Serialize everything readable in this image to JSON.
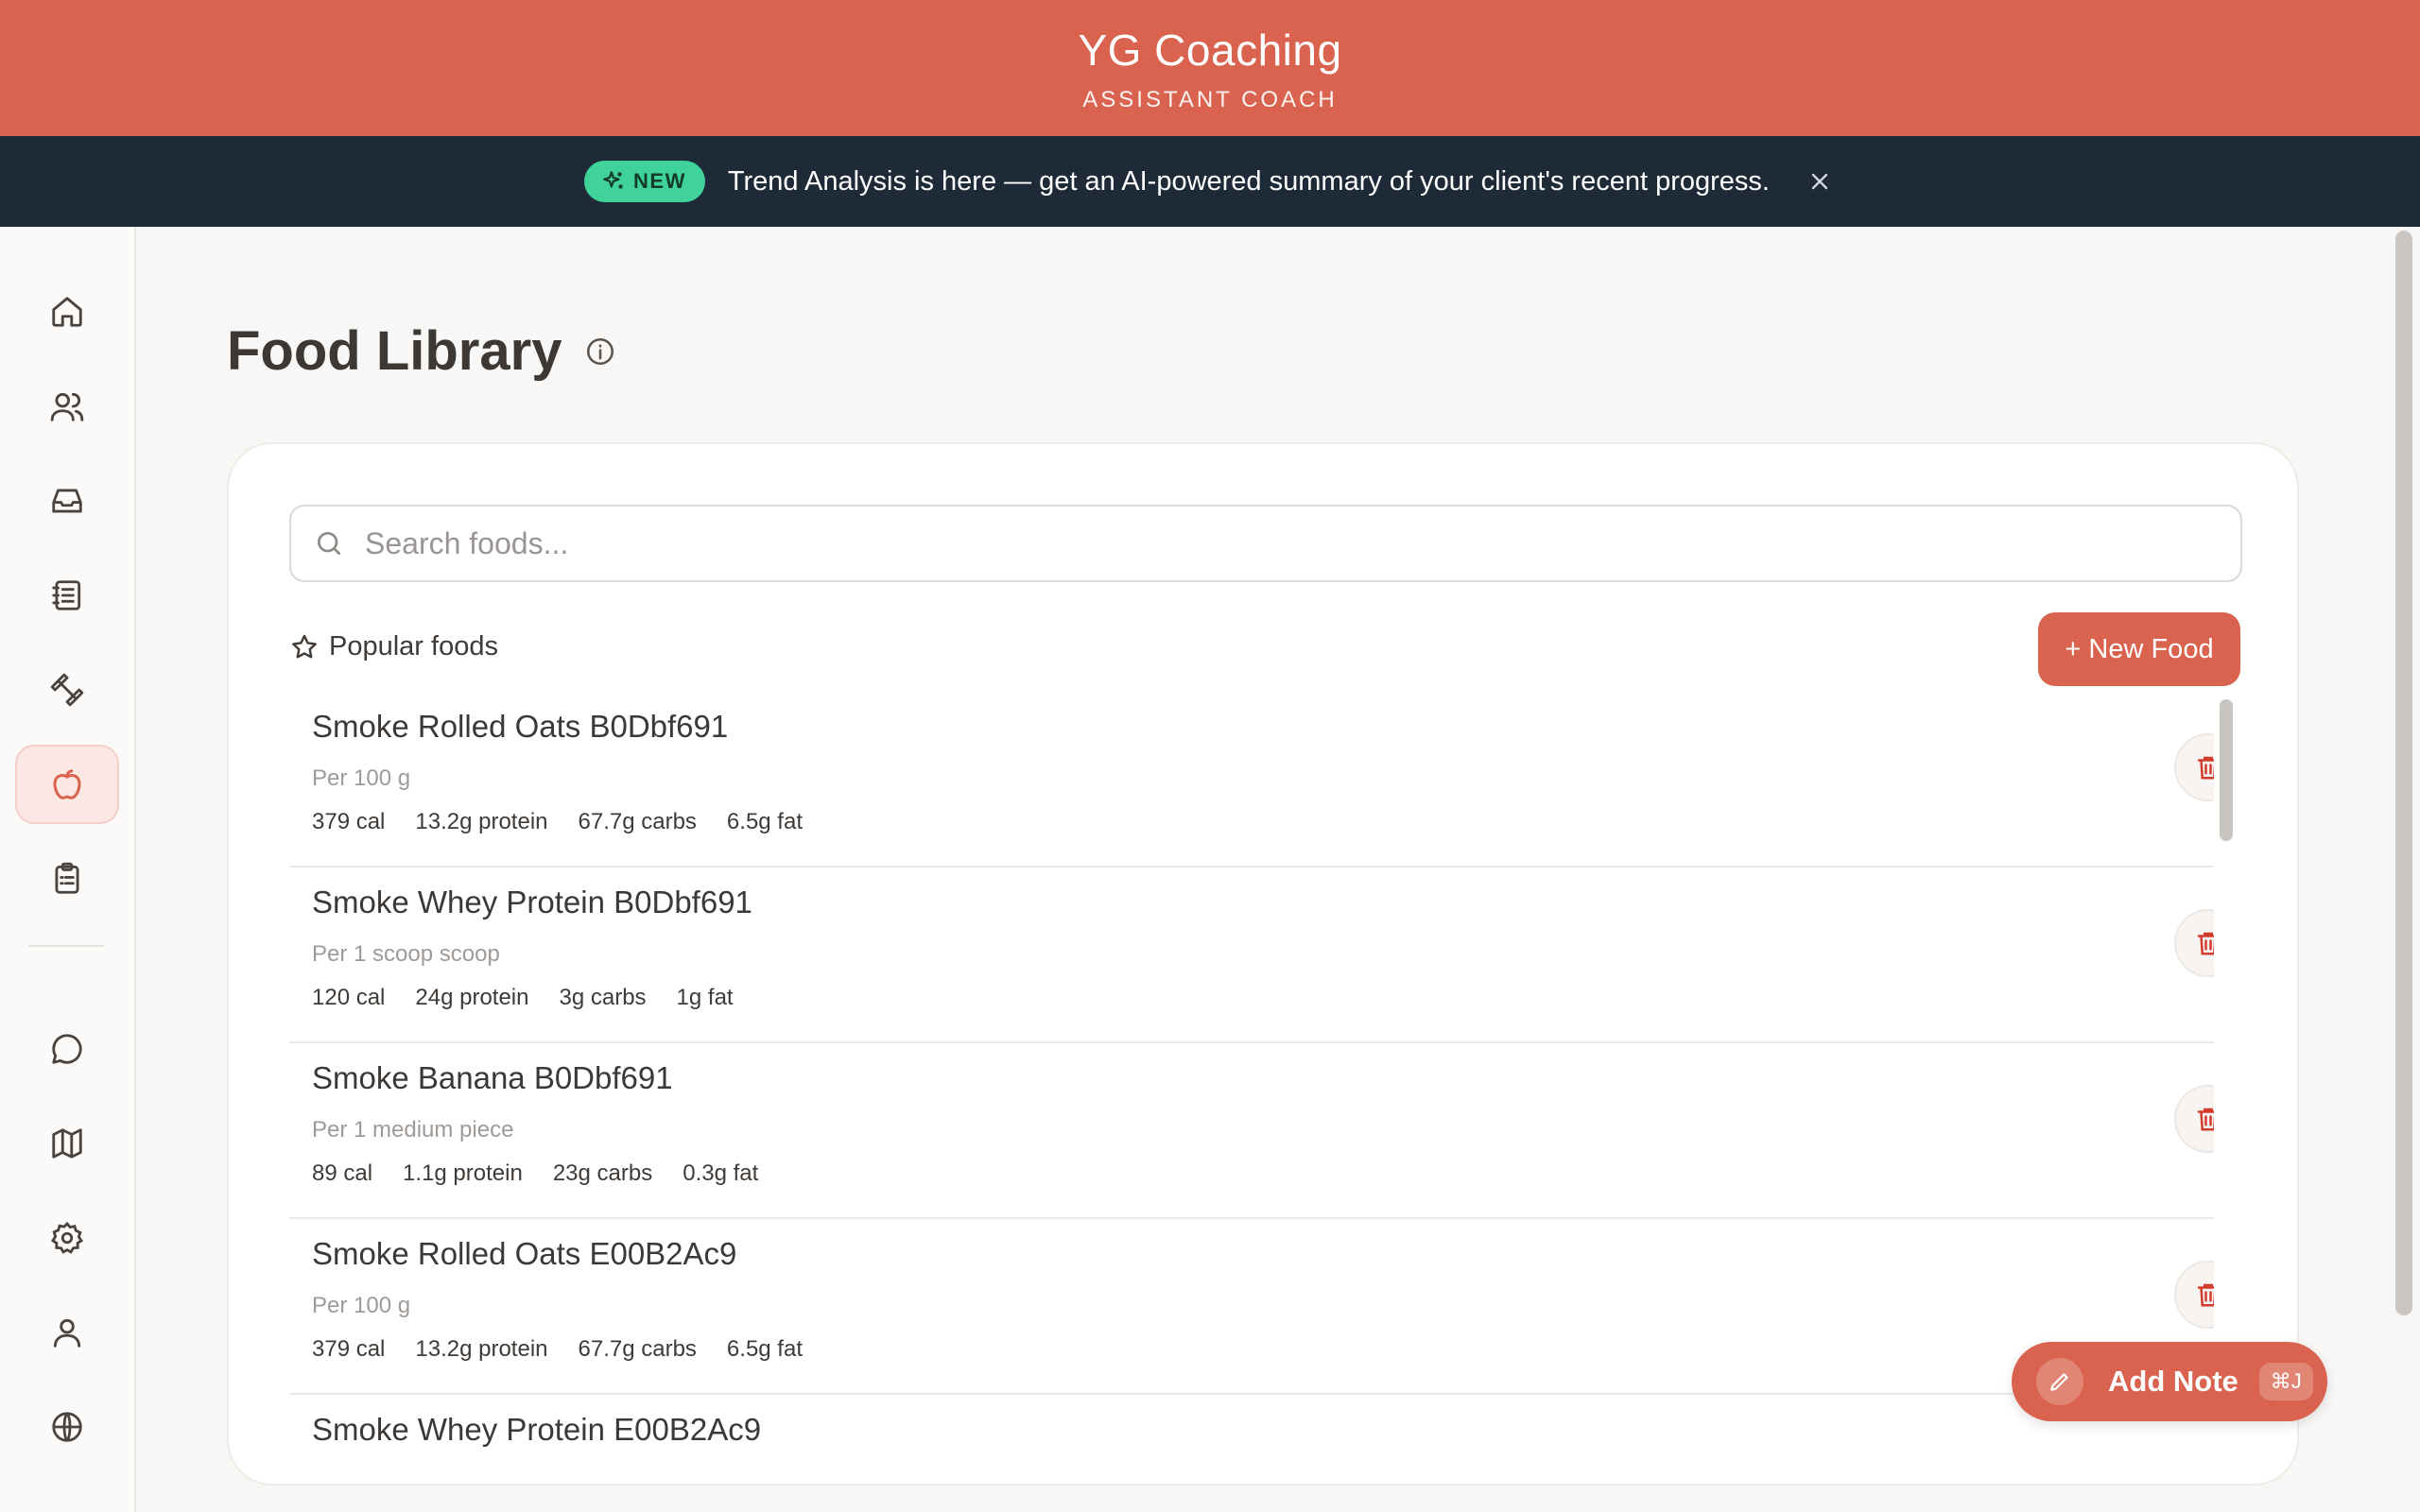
{
  "header": {
    "brand": "YG Coaching",
    "subtitle": "ASSISTANT COACH",
    "color": "#d9634f"
  },
  "announcement": {
    "badge": "NEW",
    "message": "Trend Analysis is here — get an AI-powered summary of your client's recent progress.",
    "icons": [
      "sparkle-icon",
      "close-icon"
    ]
  },
  "sidebar": {
    "items": [
      {
        "icon": "home-icon",
        "active": false
      },
      {
        "icon": "users-icon",
        "active": false
      },
      {
        "icon": "inbox-icon",
        "active": false
      },
      {
        "icon": "notebook-icon",
        "active": false
      },
      {
        "icon": "dumbbell-icon",
        "active": false
      },
      {
        "icon": "apple-icon",
        "active": true
      },
      {
        "icon": "clipboard-icon",
        "active": false
      },
      {
        "icon": "chat-icon",
        "active": false
      },
      {
        "icon": "map-icon",
        "active": false
      },
      {
        "icon": "gear-icon",
        "active": false
      },
      {
        "icon": "user-icon",
        "active": false
      },
      {
        "icon": "globe-icon",
        "active": false
      }
    ]
  },
  "main": {
    "title": "Food Library",
    "search_placeholder": "Search foods...",
    "popular_label": "Popular foods",
    "new_food_label": "+ New Food",
    "foods": [
      {
        "name": "Smoke Rolled Oats B0Dbf691",
        "serving": "Per 100 g",
        "cal": "379 cal",
        "protein": "13.2g protein",
        "carbs": "67.7g carbs",
        "fat": "6.5g fat"
      },
      {
        "name": "Smoke Whey Protein B0Dbf691",
        "serving": "Per 1 scoop scoop",
        "cal": "120 cal",
        "protein": "24g protein",
        "carbs": "3g carbs",
        "fat": "1g fat"
      },
      {
        "name": "Smoke Banana B0Dbf691",
        "serving": "Per 1 medium piece",
        "cal": "89 cal",
        "protein": "1.1g protein",
        "carbs": "23g carbs",
        "fat": "0.3g fat"
      },
      {
        "name": "Smoke Rolled Oats E00B2Ac9",
        "serving": "Per 100 g",
        "cal": "379 cal",
        "protein": "13.2g protein",
        "carbs": "67.7g carbs",
        "fat": "6.5g fat"
      },
      {
        "name": "Smoke Whey Protein E00B2Ac9",
        "serving": "",
        "cal": "",
        "protein": "",
        "carbs": "",
        "fat": ""
      }
    ]
  },
  "add_note": {
    "label": "Add Note",
    "shortcut": "⌘J"
  }
}
